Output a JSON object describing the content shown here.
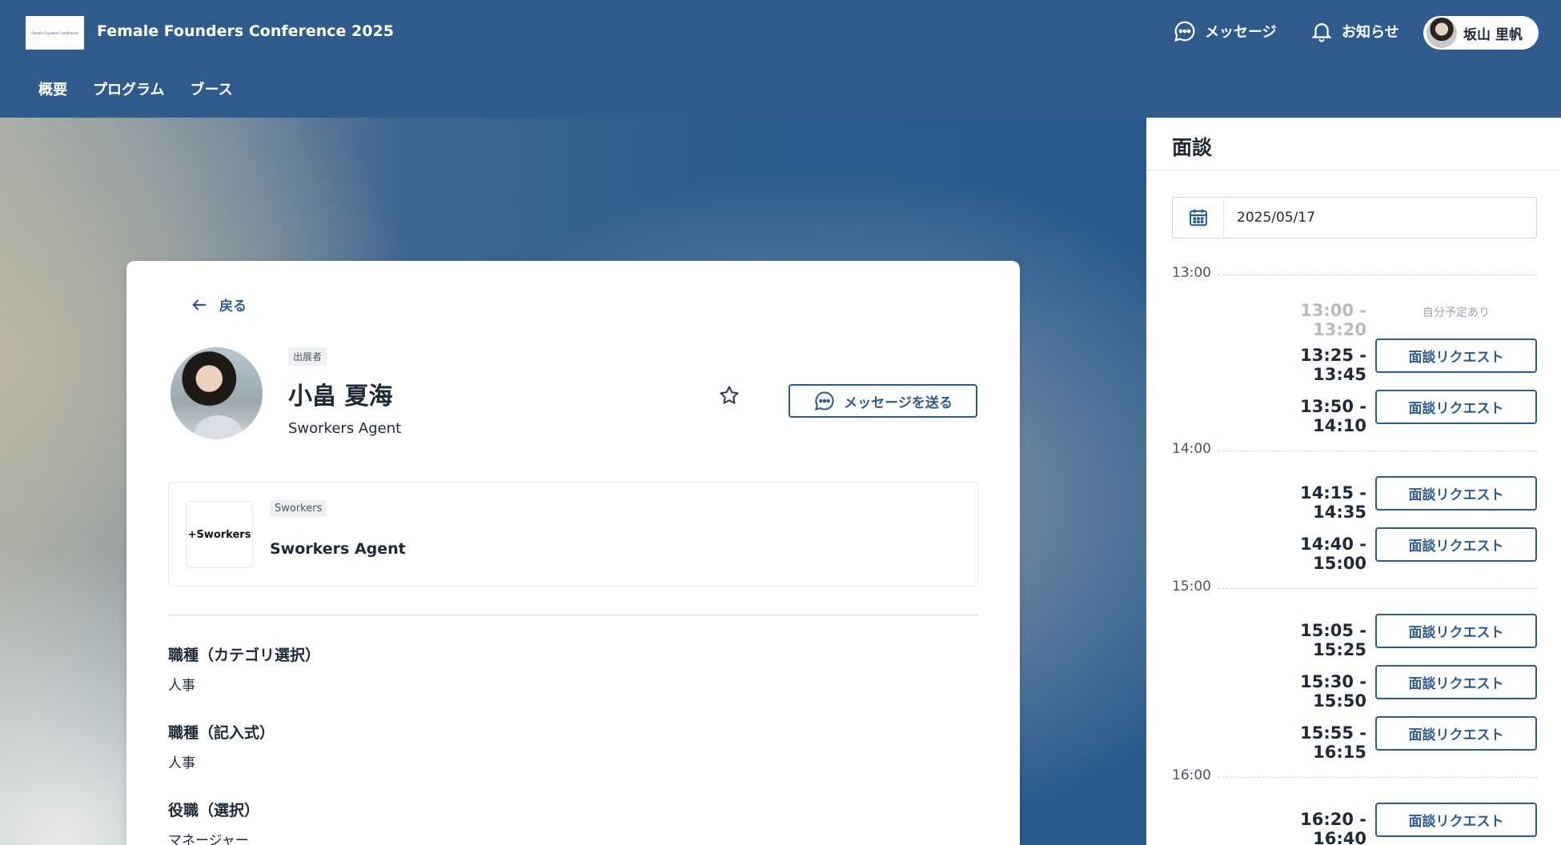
{
  "app": {
    "title": "Female Founders Conference 2025",
    "logo_text": "Female Founders Conference",
    "messages_label": "メッセージ",
    "notifications_label": "お知らせ",
    "user_name": "坂山 里帆"
  },
  "nav": {
    "items": [
      "概要",
      "プログラム",
      "ブース"
    ]
  },
  "profile": {
    "back_label": "戻る",
    "role_tag": "出展者",
    "name": "小畠 夏海",
    "company": "Sworkers Agent",
    "message_button": "メッセージを送る",
    "company_card": {
      "logo_text": "+Sworkers",
      "tag": "Sworkers",
      "name": "Sworkers Agent"
    },
    "fields": [
      {
        "label": "職種（カテゴリ選択）",
        "value": "人事"
      },
      {
        "label": "職種（記入式）",
        "value": "人事"
      },
      {
        "label": "役職（選択）",
        "value": "マネージャー"
      }
    ]
  },
  "interview": {
    "title": "面談",
    "date": "2025/05/17",
    "hours": [
      "13:00",
      "14:00",
      "15:00",
      "16:00"
    ],
    "busy_label": "自分予定あり",
    "request_label": "面談リクエスト",
    "slots": [
      {
        "time": "13:00 - 13:20",
        "status": "busy"
      },
      {
        "time": "13:25 - 13:45",
        "status": "available"
      },
      {
        "time": "13:50 - 14:10",
        "status": "available"
      },
      {
        "time": "14:15 - 14:35",
        "status": "available"
      },
      {
        "time": "14:40 - 15:00",
        "status": "available"
      },
      {
        "time": "15:05 - 15:25",
        "status": "available"
      },
      {
        "time": "15:30 - 15:50",
        "status": "available"
      },
      {
        "time": "15:55 - 16:15",
        "status": "available"
      },
      {
        "time": "16:20 - 16:40",
        "status": "available"
      }
    ]
  },
  "colors": {
    "primary": "#2f5c8c",
    "header_bg": "#2f5c8c",
    "busy_text": "#b7bcc2"
  }
}
